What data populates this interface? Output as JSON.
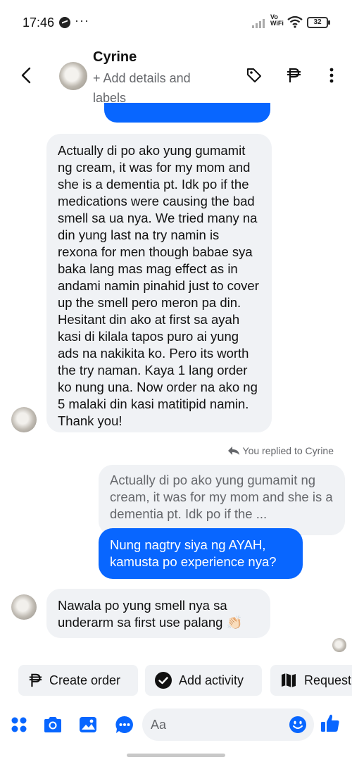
{
  "status_bar": {
    "time": "17:46",
    "dots": "···",
    "network": "Vo WiFi",
    "battery": "32"
  },
  "header": {
    "contact_name": "Cyrine",
    "subtitle": "+ Add details and labels",
    "icons": [
      "back-icon",
      "tag-icon",
      "peso-icon",
      "more-vertical-icon"
    ]
  },
  "messages": {
    "incoming_1": "Actually di po ako yung gumamit ng cream, it was for my mom and she is a dementia pt. Idk po if the medications were causing the bad smell sa ua nya. We tried many na din yung last na try namin is rexona for men though babae sya baka lang mas mag effect as in andami namin pinahid just to cover up the smell pero meron pa din. Hesitant din ako at first sa ayah kasi di kilala tapos puro ai yung ads na nakikita ko. Pero its worth the try naman. Kaya 1 lang order ko nung una. Now order na ako ng 5 malaki din kasi matitipid namin. Thank you!",
    "reply_label": "You replied to Cyrine",
    "quoted_text": "Actually di po ako yung gumamit ng cream, it was for my mom and she is a dementia pt. Idk po if the ...",
    "outgoing_1": "Nung nagtry siya ng AYAH, kamusta po experience nya?",
    "incoming_2": "Nawala po yung smell nya sa underarm sa first use palang 👏🏻"
  },
  "actions": {
    "create_order": "Create order",
    "add_activity": "Add activity",
    "request": "Request"
  },
  "composer": {
    "placeholder": "Aa",
    "icons": [
      "menu-dots-icon",
      "camera-icon",
      "gallery-icon",
      "chat-icon",
      "emoji-icon",
      "like-icon"
    ]
  },
  "colors": {
    "accent": "#0866ff",
    "incoming_bubble": "#f0f2f5",
    "secondary_text": "#65676b"
  }
}
